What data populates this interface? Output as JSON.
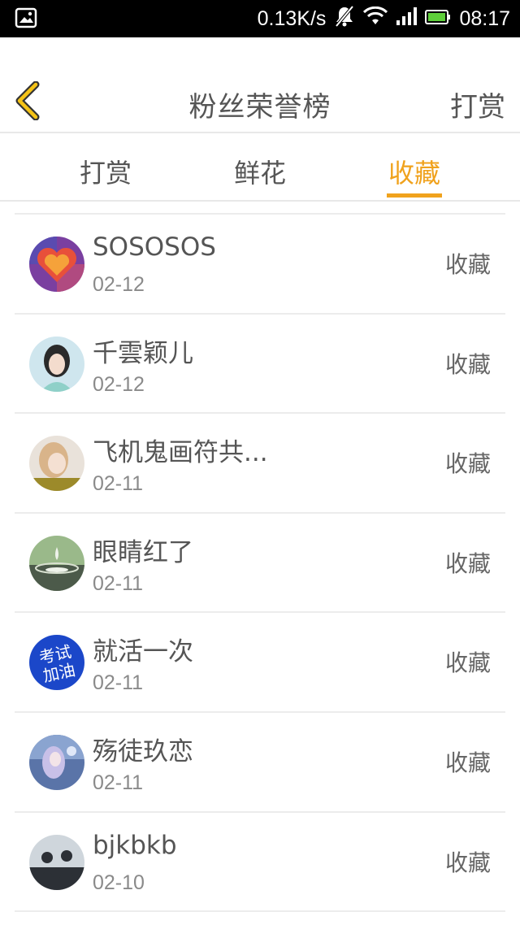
{
  "status_bar": {
    "network_speed": "0.13K/s",
    "time": "08:17",
    "icons": [
      "image-icon",
      "mute-icon",
      "wifi-icon",
      "signal-icon",
      "battery-icon"
    ]
  },
  "header": {
    "title": "粉丝荣誉榜",
    "action_label": "打赏"
  },
  "tabs": [
    {
      "label": "打赏",
      "active": false
    },
    {
      "label": "鲜花",
      "active": false
    },
    {
      "label": "收藏",
      "active": true
    }
  ],
  "colors": {
    "accent": "#f0a21d",
    "text": "#555555",
    "subtext": "#8a8a8a",
    "divider": "#ececec"
  },
  "fans": [
    {
      "name": "SOSOSOS",
      "date": "02-12",
      "action": "收藏",
      "avatar": "heart-mosaic-avatar"
    },
    {
      "name": "千雲颖儿",
      "date": "02-12",
      "action": "收藏",
      "avatar": "girl-portrait-avatar"
    },
    {
      "name": "飞机鬼画符共...",
      "date": "02-11",
      "action": "收藏",
      "avatar": "girl-selfie-avatar"
    },
    {
      "name": "眼睛红了",
      "date": "02-11",
      "action": "收藏",
      "avatar": "water-drop-avatar"
    },
    {
      "name": "就活一次",
      "date": "02-11",
      "action": "收藏",
      "avatar": "exam-badge-avatar",
      "avatar_text": [
        "考试",
        "加油"
      ]
    },
    {
      "name": "殇徒玖恋",
      "date": "02-11",
      "action": "收藏",
      "avatar": "anime-girl-avatar"
    },
    {
      "name": "bjkbkb",
      "date": "02-10",
      "action": "收藏",
      "avatar": "silhouette-couple-avatar"
    }
  ]
}
